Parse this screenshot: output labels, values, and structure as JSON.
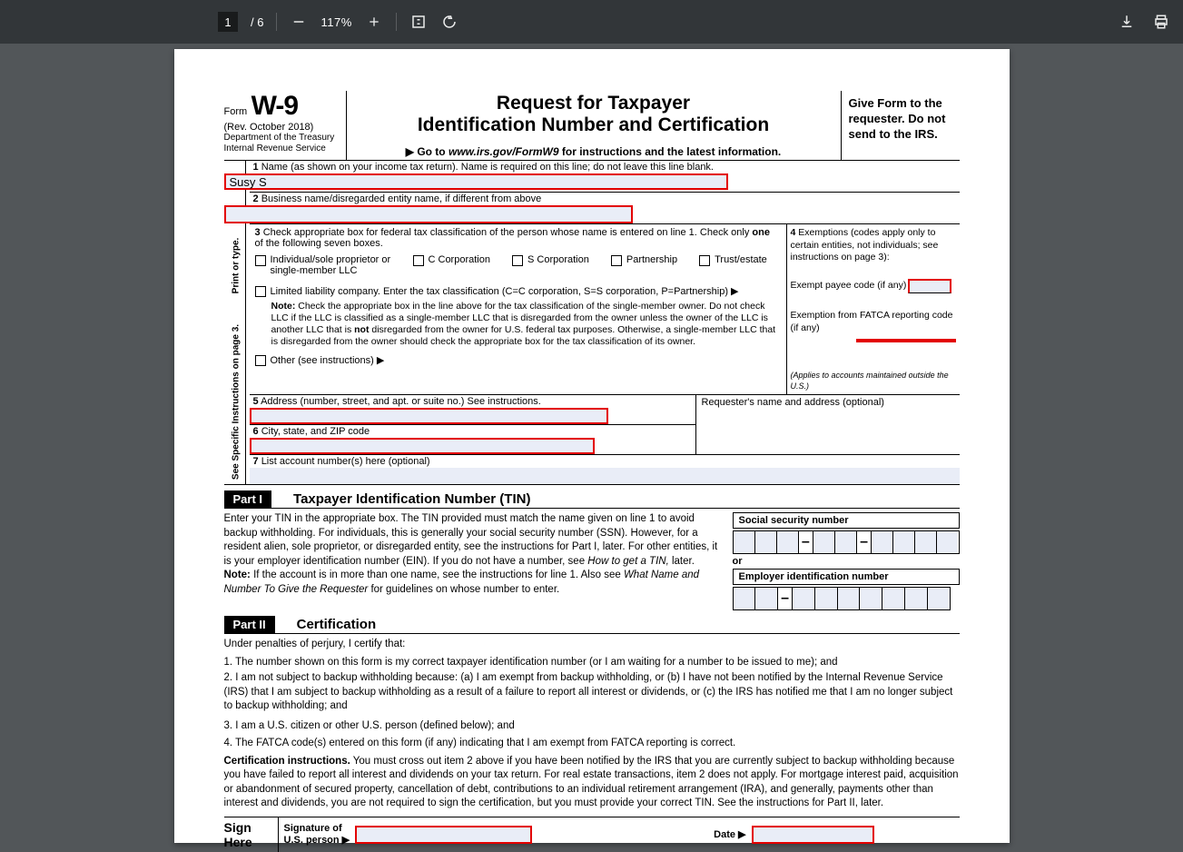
{
  "toolbar": {
    "current_page": "1",
    "page_sep": "/",
    "total_pages": "6",
    "zoom": "117%"
  },
  "form": {
    "label": "Form",
    "code": "W-9",
    "rev": "(Rev. October 2018)",
    "dept1": "Department of the Treasury",
    "dept2": "Internal Revenue Service",
    "title1": "Request for Taxpayer",
    "title2": "Identification Number and Certification",
    "goto_pre": "▶ Go to ",
    "goto_url": "www.irs.gov/FormW9",
    "goto_post": " for instructions and the latest information.",
    "give": "Give Form to the requester. Do not send to the IRS.",
    "vert1": "Print or type.",
    "vert2": "See Specific Instructions on page 3.",
    "line1_label": "1  Name (as shown on your income tax return). Name is required on this line; do not leave this line blank.",
    "line1_value": "Susy S",
    "line2_label": "2  Business name/disregarded entity name, if different from above",
    "line2_value": "",
    "line3_pre": "3  Check appropriate box for federal tax classification of the person whose name is entered on line 1. Check only ",
    "line3_one": "one",
    "line3_post": " of the following seven boxes.",
    "chk_individual": "Individual/sole proprietor or single-member LLC",
    "chk_ccorp": "C Corporation",
    "chk_scorp": "S Corporation",
    "chk_partnership": "Partnership",
    "chk_trust": "Trust/estate",
    "llc_label": "Limited liability company. Enter the tax classification (C=C corporation, S=S corporation, P=Partnership) ▶",
    "llc_note_b": "Note:",
    "llc_note": " Check the appropriate box in the line above for the tax classification of the single-member owner.  Do not check LLC if the LLC is classified as a single-member LLC that is disregarded from the owner unless the owner of the LLC is another LLC that is ",
    "llc_note_not": "not",
    "llc_note2": " disregarded from the owner for U.S. federal tax purposes. Otherwise, a single-member LLC that is disregarded from the owner should check the appropriate box for the tax classification of its owner.",
    "chk_other": "Other (see instructions) ▶",
    "line4_label": "4  Exemptions (codes apply only to certain entities, not individuals; see instructions on page 3):",
    "exempt_payee": "Exempt payee code (if any)",
    "exempt_fatca": "Exemption from FATCA reporting code (if any)",
    "applies": "(Applies to accounts maintained outside the U.S.)",
    "line5_label": "5  Address (number, street, and apt. or suite no.) See instructions.",
    "requester": "Requester's name and address (optional)",
    "line6_label": "6  City, state, and ZIP code",
    "line7_label": "7  List account number(s) here (optional)"
  },
  "part1": {
    "label": "Part I",
    "title": "Taxpayer Identification Number (TIN)",
    "para1": "Enter your TIN in the appropriate box. The TIN provided must match the name given on line 1 to avoid backup withholding. For individuals, this is generally your social security number (SSN). However, for a resident alien, sole proprietor, or disregarded entity, see the instructions for Part I, later. For other entities, it is your employer identification number (EIN). If you do not have a number, see ",
    "para1_i": "How to get a TIN,",
    "para1_post": " later.",
    "note_b": "Note:",
    "note": " If the account is in more than one name, see the instructions for line 1. Also see ",
    "note_i": "What Name and Number To Give the Requester",
    "note_post": " for guidelines on whose number to enter.",
    "ssn_label": "Social security number",
    "or": "or",
    "ein_label": "Employer identification number"
  },
  "part2": {
    "label": "Part II",
    "title": "Certification",
    "under": "Under penalties of perjury, I certify that:",
    "li1": "1. The number shown on this form is my correct taxpayer identification number (or I am waiting for a number to be issued to me); and",
    "li2": "2. I am not subject to backup withholding because: (a) I am exempt from backup withholding, or (b) I have not been notified by the Internal Revenue Service (IRS) that I am subject to backup withholding as a result of a failure to report all interest or dividends, or (c) the IRS has notified me that I am no longer subject to backup withholding; and",
    "li3": "3. I am a U.S. citizen or other U.S. person (defined below); and",
    "li4": "4. The FATCA code(s) entered on this form (if any) indicating that I am exempt from FATCA reporting is correct.",
    "cert_b": "Certification instructions.",
    "cert_txt": " You must cross out item 2 above if you have been notified by the IRS that you are currently subject to backup withholding because you have failed to report all interest and dividends on your tax return. For real estate transactions, item 2 does not apply. For mortgage interest paid, acquisition or abandonment of secured property, cancellation of debt, contributions to an individual retirement arrangement (IRA), and generally, payments other than interest and dividends, you are not required to sign the certification, but you must provide your correct TIN. See the instructions for Part II, later."
  },
  "sign": {
    "here": "Sign Here",
    "sig_label": "Signature of U.S. person ▶",
    "date_label": "Date ▶"
  }
}
